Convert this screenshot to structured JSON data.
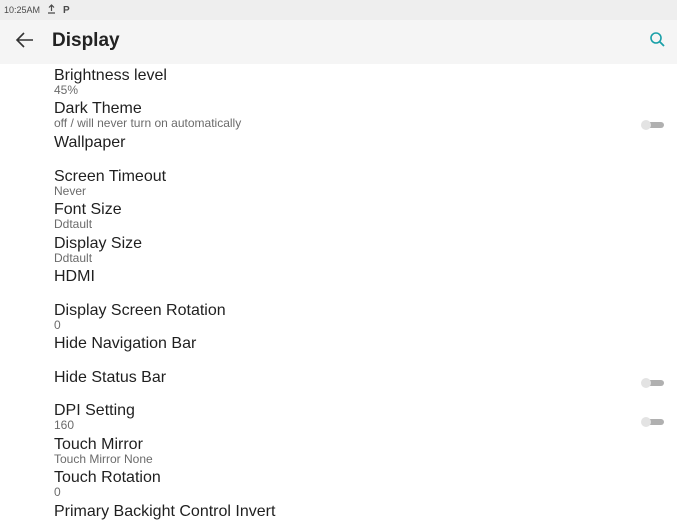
{
  "status_bar": {
    "time": "10:25AM",
    "icons": [
      "upload-icon",
      "parking-icon"
    ]
  },
  "header": {
    "title": "Display",
    "back_icon": "arrow-left-icon",
    "search_icon": "search-icon"
  },
  "colors": {
    "accent": "#1aa0a8",
    "status_bar_bg": "#eeeeee",
    "appbar_bg": "#f5f5f5",
    "toggle_off": "#b0b0b0"
  },
  "settings": [
    {
      "title": "Brightness level",
      "summary": "45%"
    },
    {
      "title": "Dark Theme",
      "summary": "off / will never turn on automatically",
      "toggle": "off"
    },
    {
      "title": "Wallpaper"
    },
    {
      "title": "Screen Timeout",
      "summary": "Never"
    },
    {
      "title": "Font Size",
      "summary": "Ddtault"
    },
    {
      "title": "Display Size",
      "summary": "Ddtault"
    },
    {
      "title": "HDMI"
    },
    {
      "title": "Display Screen Rotation",
      "summary": "0"
    },
    {
      "title": "Hide Navigation Bar"
    },
    {
      "title": "Hide Status Bar",
      "toggle": "off"
    },
    {
      "title": "DPI Setting",
      "summary": "160",
      "toggle": "off"
    },
    {
      "title": "Touch Mirror",
      "summary": "Touch Mirror None"
    },
    {
      "title": "Touch Rotation",
      "summary": "0"
    },
    {
      "title": "Primary Backight Control Invert"
    }
  ]
}
